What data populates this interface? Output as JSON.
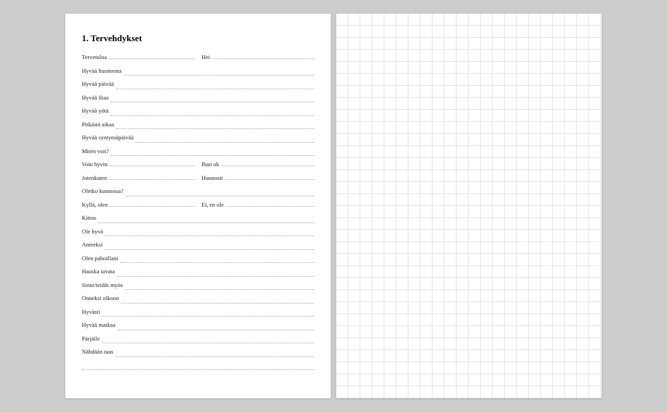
{
  "heading": "1. Tervehdykset",
  "rows": [
    {
      "type": "split",
      "a": "Tervetuloa",
      "b": "Hei"
    },
    {
      "type": "full",
      "a": "Hyvää huomenta"
    },
    {
      "type": "full",
      "a": "Hyvää päivää"
    },
    {
      "type": "full",
      "a": "Hyvää iltaa"
    },
    {
      "type": "full",
      "a": "Hyvää yötä"
    },
    {
      "type": "full",
      "a": "Pitkästä aikaa"
    },
    {
      "type": "full",
      "a": "Hyvää syntymäpäivää"
    },
    {
      "type": "full",
      "a": "Miten voit?"
    },
    {
      "type": "split",
      "a": "Voin hyvin",
      "b": "Ihan ok"
    },
    {
      "type": "split",
      "a": "Jotenkuten",
      "b": "Huonosti"
    },
    {
      "type": "full",
      "a": "Oletko kunnossa?"
    },
    {
      "type": "split",
      "a": "Kyllä, olen",
      "b": "Ei, en ole"
    },
    {
      "type": "full",
      "a": "Kiitos"
    },
    {
      "type": "full",
      "a": "Ole hyvä"
    },
    {
      "type": "full",
      "a": "Anteeksi"
    },
    {
      "type": "full",
      "a": "Olen pahoillani"
    },
    {
      "type": "full",
      "a": "Hauska tavata"
    },
    {
      "type": "full",
      "a": "Sinut/teidät myös"
    },
    {
      "type": "full",
      "a": "Onneksi olkoon"
    },
    {
      "type": "full",
      "a": "Hyvästi"
    },
    {
      "type": "full",
      "a": "Hyvää matkaa"
    },
    {
      "type": "full",
      "a": "Pärjäile"
    },
    {
      "type": "full",
      "a": "Nähdään taas"
    },
    {
      "type": "blank"
    }
  ]
}
